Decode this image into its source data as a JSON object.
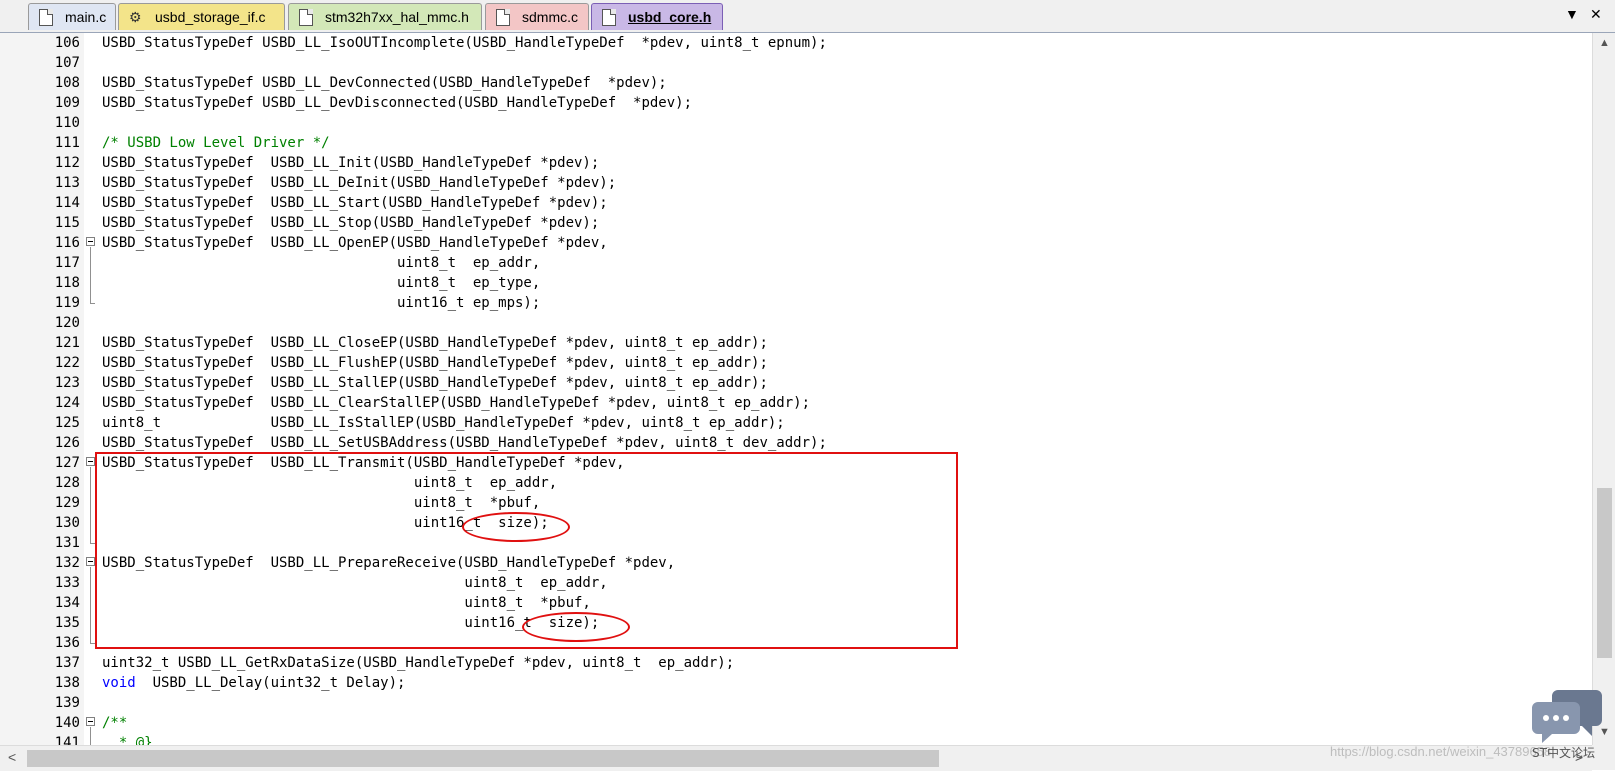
{
  "tabs": [
    {
      "label": "main.c",
      "icon": "file-icon"
    },
    {
      "label": "usbd_storage_if.c",
      "icon": "gear-file-icon"
    },
    {
      "label": "stm32h7xx_hal_mmc.h",
      "icon": "file-icon"
    },
    {
      "label": "sdmmc.c",
      "icon": "file-icon"
    },
    {
      "label": "usbd_core.h",
      "icon": "file-icon",
      "active": true
    }
  ],
  "tab_menu": {
    "left_arrow": "▼",
    "close": "✕"
  },
  "editor": {
    "lines": [
      {
        "n": "106",
        "text": "USBD_StatusTypeDef USBD_LL_IsoOUTIncomplete(USBD_HandleTypeDef  *pdev, uint8_t epnum);"
      },
      {
        "n": "107",
        "text": ""
      },
      {
        "n": "108",
        "text": "USBD_StatusTypeDef USBD_LL_DevConnected(USBD_HandleTypeDef  *pdev);"
      },
      {
        "n": "109",
        "text": "USBD_StatusTypeDef USBD_LL_DevDisconnected(USBD_HandleTypeDef  *pdev);"
      },
      {
        "n": "110",
        "text": ""
      },
      {
        "n": "111",
        "text": "/* USBD Low Level Driver */",
        "comment": true
      },
      {
        "n": "112",
        "text": "USBD_StatusTypeDef  USBD_LL_Init(USBD_HandleTypeDef *pdev);"
      },
      {
        "n": "113",
        "text": "USBD_StatusTypeDef  USBD_LL_DeInit(USBD_HandleTypeDef *pdev);"
      },
      {
        "n": "114",
        "text": "USBD_StatusTypeDef  USBD_LL_Start(USBD_HandleTypeDef *pdev);"
      },
      {
        "n": "115",
        "text": "USBD_StatusTypeDef  USBD_LL_Stop(USBD_HandleTypeDef *pdev);"
      },
      {
        "n": "116",
        "text": "USBD_StatusTypeDef  USBD_LL_OpenEP(USBD_HandleTypeDef *pdev,",
        "fold": true
      },
      {
        "n": "117",
        "text": "                                   uint8_t  ep_addr,"
      },
      {
        "n": "118",
        "text": "                                   uint8_t  ep_type,"
      },
      {
        "n": "119",
        "text": "                                   uint16_t ep_mps);"
      },
      {
        "n": "120",
        "text": ""
      },
      {
        "n": "121",
        "text": "USBD_StatusTypeDef  USBD_LL_CloseEP(USBD_HandleTypeDef *pdev, uint8_t ep_addr);"
      },
      {
        "n": "122",
        "text": "USBD_StatusTypeDef  USBD_LL_FlushEP(USBD_HandleTypeDef *pdev, uint8_t ep_addr);"
      },
      {
        "n": "123",
        "text": "USBD_StatusTypeDef  USBD_LL_StallEP(USBD_HandleTypeDef *pdev, uint8_t ep_addr);"
      },
      {
        "n": "124",
        "text": "USBD_StatusTypeDef  USBD_LL_ClearStallEP(USBD_HandleTypeDef *pdev, uint8_t ep_addr);"
      },
      {
        "n": "125",
        "text": "uint8_t             USBD_LL_IsStallEP(USBD_HandleTypeDef *pdev, uint8_t ep_addr);"
      },
      {
        "n": "126",
        "text": "USBD_StatusTypeDef  USBD_LL_SetUSBAddress(USBD_HandleTypeDef *pdev, uint8_t dev_addr);"
      },
      {
        "n": "127",
        "text": "USBD_StatusTypeDef  USBD_LL_Transmit(USBD_HandleTypeDef *pdev,",
        "fold": true
      },
      {
        "n": "128",
        "text": "                                     uint8_t  ep_addr,"
      },
      {
        "n": "129",
        "text": "                                     uint8_t  *pbuf,"
      },
      {
        "n": "130",
        "text": "                                     uint16_t  size);"
      },
      {
        "n": "131",
        "text": ""
      },
      {
        "n": "132",
        "text": "USBD_StatusTypeDef  USBD_LL_PrepareReceive(USBD_HandleTypeDef *pdev,",
        "fold": true
      },
      {
        "n": "133",
        "text": "                                           uint8_t  ep_addr,"
      },
      {
        "n": "134",
        "text": "                                           uint8_t  *pbuf,"
      },
      {
        "n": "135",
        "text": "                                           uint16_t  size);"
      },
      {
        "n": "136",
        "text": ""
      },
      {
        "n": "137",
        "text": "uint32_t USBD_LL_GetRxDataSize(USBD_HandleTypeDef *pdev, uint8_t  ep_addr);"
      },
      {
        "n": "138",
        "text": "void  USBD_LL_Delay(uint32_t Delay);",
        "keyword": "void"
      },
      {
        "n": "139",
        "text": ""
      },
      {
        "n": "140",
        "text": "/**",
        "comment": true,
        "fold": true
      },
      {
        "n": "141",
        "text": "  * @}",
        "comment": true
      }
    ]
  },
  "watermark": "https://blog.csdn.net/weixin_43789658",
  "forum_label": "ST中文论坛",
  "colors": {
    "comment": "#008000",
    "keyword": "#0000ff",
    "annotation": "#e01010"
  }
}
